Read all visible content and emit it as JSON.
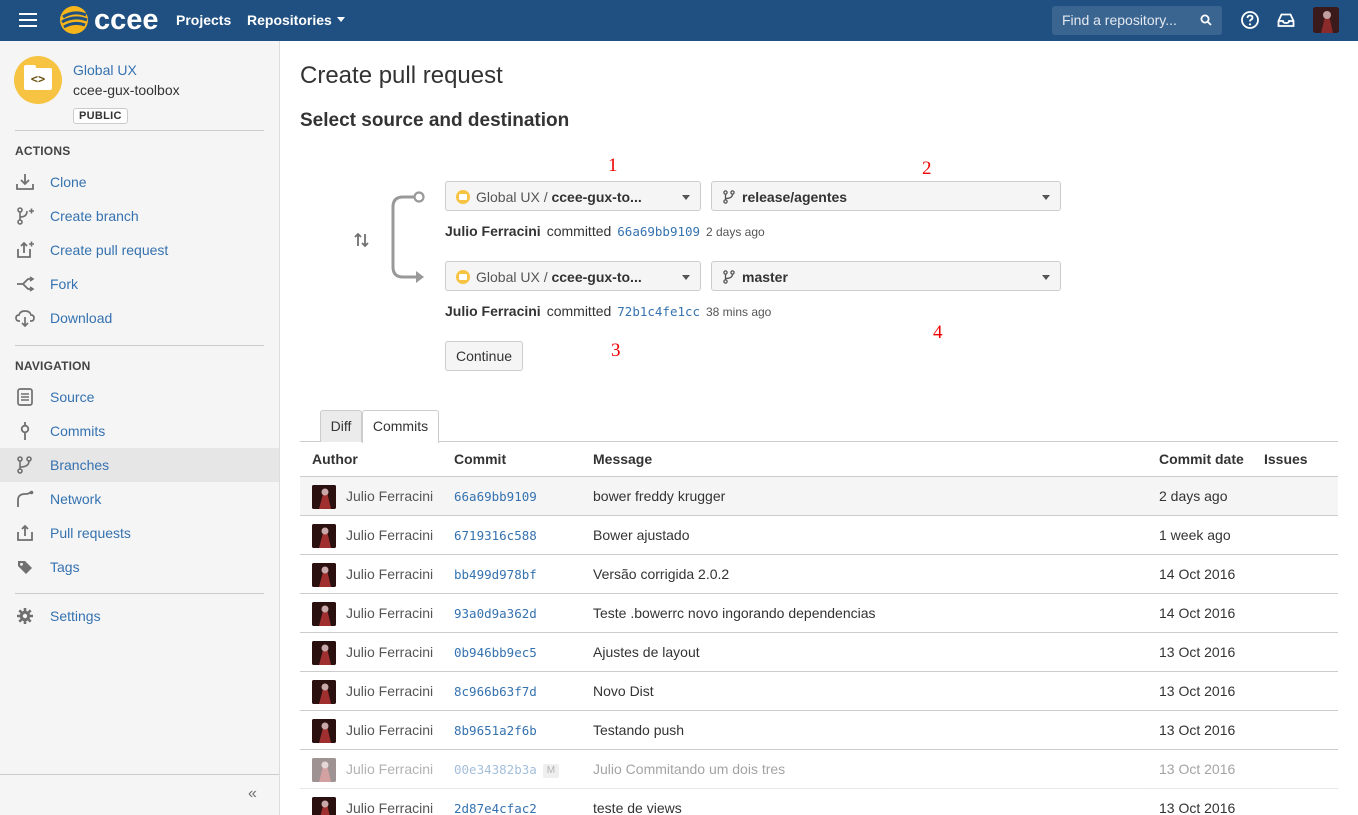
{
  "topbar": {
    "logo_text": "ccee",
    "nav_projects": "Projects",
    "nav_repositories": "Repositories",
    "search_placeholder": "Find a repository...",
    "colors": {
      "bar": "#205081",
      "link": "#3572b0"
    }
  },
  "sidebar": {
    "project_name": "Global UX",
    "repo_name": "ccee-gux-toolbox",
    "visibility_badge": "PUBLIC",
    "actions_heading": "ACTIONS",
    "actions": [
      {
        "label": "Clone",
        "icon": "clone-icon"
      },
      {
        "label": "Create branch",
        "icon": "create-branch-icon"
      },
      {
        "label": "Create pull request",
        "icon": "create-pull-request-icon"
      },
      {
        "label": "Fork",
        "icon": "fork-icon"
      },
      {
        "label": "Download",
        "icon": "download-icon"
      }
    ],
    "navigation_heading": "NAVIGATION",
    "navigation": [
      {
        "label": "Source",
        "icon": "source-icon"
      },
      {
        "label": "Commits",
        "icon": "commits-icon"
      },
      {
        "label": "Branches",
        "icon": "branches-icon",
        "active": true
      },
      {
        "label": "Network",
        "icon": "network-icon"
      },
      {
        "label": "Pull requests",
        "icon": "pull-requests-icon"
      },
      {
        "label": "Tags",
        "icon": "tags-icon"
      }
    ],
    "settings_label": "Settings",
    "collapse_glyph": "«"
  },
  "main": {
    "page_title": "Create pull request",
    "section_title": "Select source and destination",
    "annotations": [
      "1",
      "2",
      "3",
      "4"
    ],
    "source": {
      "repo_prefix": "Global UX / ",
      "repo_name": "ccee-gux-to...",
      "branch": "release/agentes",
      "author": "Julio Ferracini",
      "verb": "committed",
      "hash": "66a69bb9109",
      "ago": "2 days ago"
    },
    "destination": {
      "repo_prefix": "Global UX / ",
      "repo_name": "ccee-gux-to...",
      "branch": "master",
      "author": "Julio Ferracini",
      "verb": "committed",
      "hash": "72b1c4fe1cc",
      "ago": "38 mins ago"
    },
    "continue_label": "Continue",
    "tabs": [
      "Diff",
      "Commits"
    ],
    "table": {
      "headers": [
        "Author",
        "Commit",
        "Message",
        "Commit date",
        "Issues"
      ],
      "rows": [
        {
          "author": "Julio Ferracini",
          "commit": "66a69bb9109",
          "message": "bower freddy krugger",
          "date": "2 days ago"
        },
        {
          "author": "Julio Ferracini",
          "commit": "6719316c588",
          "message": "Bower ajustado",
          "date": "1 week ago"
        },
        {
          "author": "Julio Ferracini",
          "commit": "bb499d978bf",
          "message": "Versão corrigida 2.0.2",
          "date": "14 Oct 2016"
        },
        {
          "author": "Julio Ferracini",
          "commit": "93a0d9a362d",
          "message": "Teste .bowerrc novo ingorando dependencias",
          "date": "14 Oct 2016"
        },
        {
          "author": "Julio Ferracini",
          "commit": "0b946bb9ec5",
          "message": "Ajustes de layout",
          "date": "13 Oct 2016"
        },
        {
          "author": "Julio Ferracini",
          "commit": "8c966b63f7d",
          "message": "Novo Dist",
          "date": "13 Oct 2016"
        },
        {
          "author": "Julio Ferracini",
          "commit": "8b9651a2f6b",
          "message": "Testando push",
          "date": "13 Oct 2016"
        },
        {
          "author": "Julio Ferracini",
          "commit": "00e34382b3a",
          "merge_badge": "M",
          "message": "Julio Commitando um dois tres",
          "date": "13 Oct 2016"
        },
        {
          "author": "Julio Ferracini",
          "commit": "2d87e4cfac2",
          "message": "teste de views",
          "date": "13 Oct 2016"
        }
      ]
    }
  }
}
